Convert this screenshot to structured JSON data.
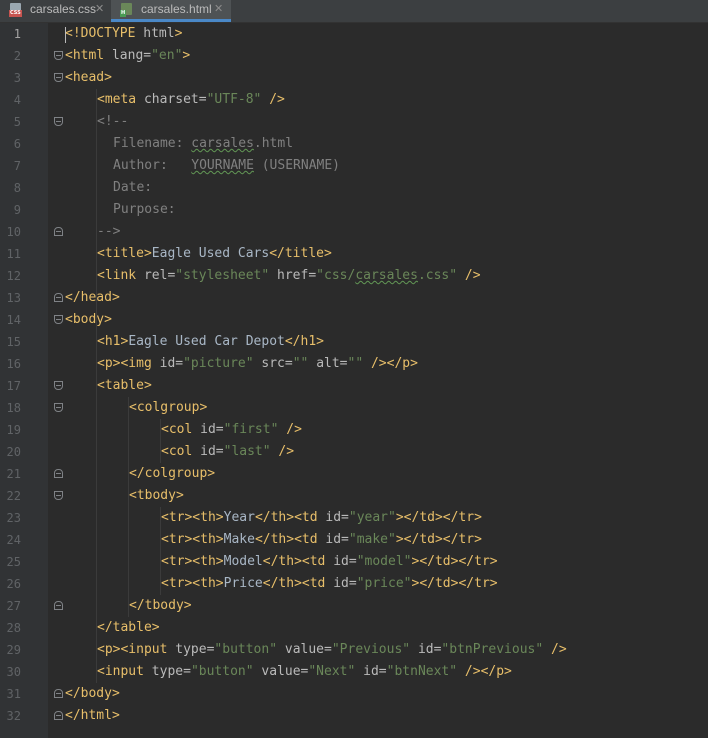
{
  "tabs": [
    {
      "label": "carsales.css",
      "type": "CSS",
      "active": false
    },
    {
      "label": "carsales.html",
      "type": "H",
      "active": true
    }
  ],
  "lines": [
    {
      "n": "1",
      "indent": 0,
      "fold": "",
      "segs": [
        [
          "d",
          "<!DOCTYPE "
        ],
        [
          "a",
          "html"
        ],
        [
          "d",
          ">"
        ]
      ]
    },
    {
      "n": "2",
      "indent": 0,
      "fold": "open",
      "segs": [
        [
          "t",
          "<html "
        ],
        [
          "a",
          "lang="
        ],
        [
          "v",
          "\"en\""
        ],
        [
          "t",
          ">"
        ]
      ]
    },
    {
      "n": "3",
      "indent": 0,
      "fold": "open",
      "segs": [
        [
          "t",
          "<head>"
        ]
      ]
    },
    {
      "n": "4",
      "indent": 4,
      "fold": "",
      "segs": [
        [
          "t",
          "<meta "
        ],
        [
          "a",
          "charset="
        ],
        [
          "v",
          "\"UTF-8\""
        ],
        [
          "t",
          " />"
        ]
      ]
    },
    {
      "n": "5",
      "indent": 4,
      "fold": "open",
      "segs": [
        [
          "c",
          "<!--"
        ]
      ]
    },
    {
      "n": "6",
      "indent": 6,
      "fold": "",
      "segs": [
        [
          "c",
          "Filename: "
        ],
        [
          "c sq",
          "carsales"
        ],
        [
          "c",
          ".html"
        ]
      ]
    },
    {
      "n": "7",
      "indent": 6,
      "fold": "",
      "segs": [
        [
          "c",
          "Author:   "
        ],
        [
          "c sq",
          "YOURNAME"
        ],
        [
          "c",
          " (USERNAME)"
        ]
      ]
    },
    {
      "n": "8",
      "indent": 6,
      "fold": "",
      "segs": [
        [
          "c",
          "Date:"
        ]
      ]
    },
    {
      "n": "9",
      "indent": 6,
      "fold": "",
      "segs": [
        [
          "c",
          "Purpose:"
        ]
      ]
    },
    {
      "n": "10",
      "indent": 4,
      "fold": "close",
      "segs": [
        [
          "c",
          "-->"
        ]
      ]
    },
    {
      "n": "11",
      "indent": 4,
      "fold": "",
      "segs": [
        [
          "t",
          "<title>"
        ],
        [
          "p",
          "Eagle Used Cars"
        ],
        [
          "t",
          "</title>"
        ]
      ]
    },
    {
      "n": "12",
      "indent": 4,
      "fold": "",
      "segs": [
        [
          "t",
          "<link "
        ],
        [
          "a",
          "rel="
        ],
        [
          "v",
          "\"stylesheet\" "
        ],
        [
          "a",
          "href="
        ],
        [
          "v",
          "\"css/"
        ],
        [
          "v sq",
          "carsales"
        ],
        [
          "v",
          ".css\""
        ],
        [
          "t",
          " />"
        ]
      ]
    },
    {
      "n": "13",
      "indent": 0,
      "fold": "close",
      "segs": [
        [
          "t",
          "</head>"
        ]
      ]
    },
    {
      "n": "14",
      "indent": 0,
      "fold": "open",
      "segs": [
        [
          "t",
          "<body>"
        ]
      ]
    },
    {
      "n": "15",
      "indent": 4,
      "fold": "",
      "segs": [
        [
          "t",
          "<h1>"
        ],
        [
          "p",
          "Eagle Used Car Depot"
        ],
        [
          "t",
          "</h1>"
        ]
      ]
    },
    {
      "n": "16",
      "indent": 4,
      "fold": "",
      "segs": [
        [
          "t",
          "<p><img "
        ],
        [
          "a",
          "id="
        ],
        [
          "v",
          "\"picture\" "
        ],
        [
          "a",
          "src="
        ],
        [
          "v",
          "\"\" "
        ],
        [
          "a",
          "alt="
        ],
        [
          "v",
          "\"\" "
        ],
        [
          "t",
          "/></p>"
        ]
      ]
    },
    {
      "n": "17",
      "indent": 4,
      "fold": "open",
      "segs": [
        [
          "t",
          "<table>"
        ]
      ]
    },
    {
      "n": "18",
      "indent": 8,
      "fold": "open",
      "segs": [
        [
          "t",
          "<colgroup>"
        ]
      ]
    },
    {
      "n": "19",
      "indent": 12,
      "fold": "",
      "segs": [
        [
          "t",
          "<col "
        ],
        [
          "a",
          "id="
        ],
        [
          "v",
          "\"first\" "
        ],
        [
          "t",
          "/>"
        ]
      ]
    },
    {
      "n": "20",
      "indent": 12,
      "fold": "",
      "segs": [
        [
          "t",
          "<col "
        ],
        [
          "a",
          "id="
        ],
        [
          "v",
          "\"last\" "
        ],
        [
          "t",
          "/>"
        ]
      ]
    },
    {
      "n": "21",
      "indent": 8,
      "fold": "close",
      "segs": [
        [
          "t",
          "</colgroup>"
        ]
      ]
    },
    {
      "n": "22",
      "indent": 8,
      "fold": "open",
      "segs": [
        [
          "t",
          "<tbody>"
        ]
      ]
    },
    {
      "n": "23",
      "indent": 12,
      "fold": "",
      "segs": [
        [
          "t",
          "<tr><th>"
        ],
        [
          "p",
          "Year"
        ],
        [
          "t",
          "</th><td "
        ],
        [
          "a",
          "id="
        ],
        [
          "v",
          "\"year\""
        ],
        [
          "t",
          "></td></tr>"
        ]
      ]
    },
    {
      "n": "24",
      "indent": 12,
      "fold": "",
      "segs": [
        [
          "t",
          "<tr><th>"
        ],
        [
          "p",
          "Make"
        ],
        [
          "t",
          "</th><td "
        ],
        [
          "a",
          "id="
        ],
        [
          "v",
          "\"make\""
        ],
        [
          "t",
          "></td></tr>"
        ]
      ]
    },
    {
      "n": "25",
      "indent": 12,
      "fold": "",
      "segs": [
        [
          "t",
          "<tr><th>"
        ],
        [
          "p",
          "Model"
        ],
        [
          "t",
          "</th><td "
        ],
        [
          "a",
          "id="
        ],
        [
          "v",
          "\"model\""
        ],
        [
          "t",
          "></td></tr>"
        ]
      ]
    },
    {
      "n": "26",
      "indent": 12,
      "fold": "",
      "segs": [
        [
          "t",
          "<tr><th>"
        ],
        [
          "p",
          "Price"
        ],
        [
          "t",
          "</th><td "
        ],
        [
          "a",
          "id="
        ],
        [
          "v",
          "\"price\""
        ],
        [
          "t",
          "></td></tr>"
        ]
      ]
    },
    {
      "n": "27",
      "indent": 8,
      "fold": "close",
      "segs": [
        [
          "t",
          "</tbody>"
        ]
      ]
    },
    {
      "n": "28",
      "indent": 4,
      "fold": "",
      "segs": [
        [
          "t",
          "</table>"
        ]
      ]
    },
    {
      "n": "29",
      "indent": 4,
      "fold": "",
      "segs": [
        [
          "t",
          "<p><input "
        ],
        [
          "a",
          "type="
        ],
        [
          "v",
          "\"button\" "
        ],
        [
          "a",
          "value="
        ],
        [
          "v",
          "\"Previous\" "
        ],
        [
          "a",
          "id="
        ],
        [
          "v",
          "\"btnPrevious\" "
        ],
        [
          "t",
          "/>"
        ]
      ]
    },
    {
      "n": "30",
      "indent": 4,
      "fold": "",
      "segs": [
        [
          "t",
          "<input "
        ],
        [
          "a",
          "type="
        ],
        [
          "v",
          "\"button\" "
        ],
        [
          "a",
          "value="
        ],
        [
          "v",
          "\"Next\" "
        ],
        [
          "a",
          "id="
        ],
        [
          "v",
          "\"btnNext\" "
        ],
        [
          "t",
          "/></p>"
        ]
      ]
    },
    {
      "n": "31",
      "indent": 0,
      "fold": "close",
      "segs": [
        [
          "t",
          "</body>"
        ]
      ]
    },
    {
      "n": "32",
      "indent": 0,
      "fold": "close",
      "segs": [
        [
          "t",
          "</html>"
        ]
      ]
    }
  ]
}
